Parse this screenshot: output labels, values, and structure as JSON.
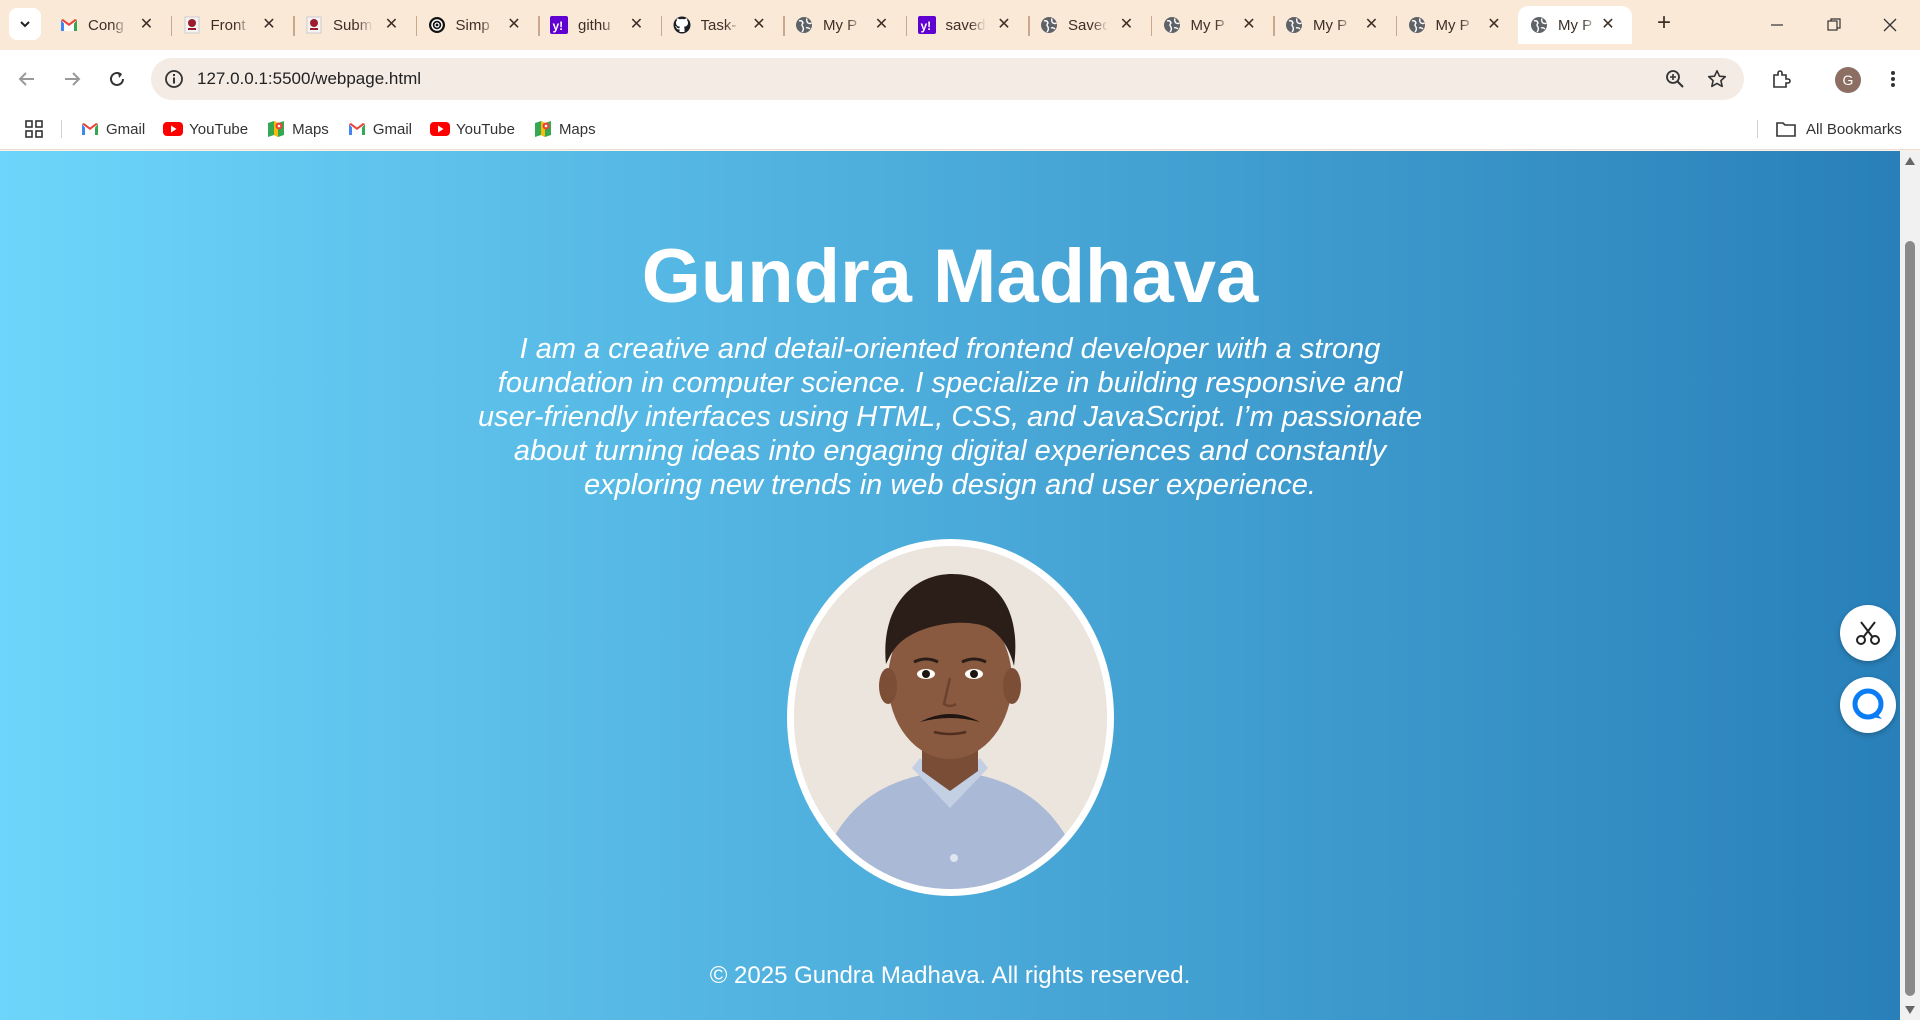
{
  "browser": {
    "tabs": [
      {
        "title": "Cong",
        "icon": "gmail-icon"
      },
      {
        "title": "Front",
        "icon": "college-icon"
      },
      {
        "title": "Subm",
        "icon": "college-icon"
      },
      {
        "title": "Simp",
        "icon": "openai-icon"
      },
      {
        "title": "githu",
        "icon": "yahoo-icon"
      },
      {
        "title": "Task-",
        "icon": "github-icon"
      },
      {
        "title": "My P",
        "icon": "globe-icon"
      },
      {
        "title": "saved",
        "icon": "yahoo-icon"
      },
      {
        "title": "Saved",
        "icon": "globe-icon"
      },
      {
        "title": "My P",
        "icon": "globe-icon"
      },
      {
        "title": "My P",
        "icon": "globe-icon"
      },
      {
        "title": "My P",
        "icon": "globe-icon"
      }
    ],
    "active_tab": {
      "title": "My P",
      "icon": "globe-icon"
    },
    "close_glyph": "✕",
    "new_tab_glyph": "+",
    "url": "127.0.0.1:5500/webpage.html",
    "avatar_letter": "G",
    "bookmarks": [
      {
        "label": "Gmail",
        "icon": "gmail-icon"
      },
      {
        "label": "YouTube",
        "icon": "youtube-icon"
      },
      {
        "label": "Maps",
        "icon": "maps-icon"
      },
      {
        "label": "Gmail",
        "icon": "gmail-icon"
      },
      {
        "label": "YouTube",
        "icon": "youtube-icon"
      },
      {
        "label": "Maps",
        "icon": "maps-icon"
      }
    ],
    "all_bookmarks_label": "All Bookmarks"
  },
  "page": {
    "name": "Gundra Madhava",
    "description": "I am a creative and detail-oriented frontend developer with a strong foundation in computer science. I specialize in building responsive and user-friendly interfaces using HTML, CSS, and JavaScript. I’m passionate about turning ideas into engaging digital experiences and constantly exploring new trends in web design and user experience.",
    "footer": "© 2025 Gundra Madhava. All rights reserved.",
    "gradient": {
      "from": "#6dd5fa",
      "to": "#2980b9"
    }
  }
}
